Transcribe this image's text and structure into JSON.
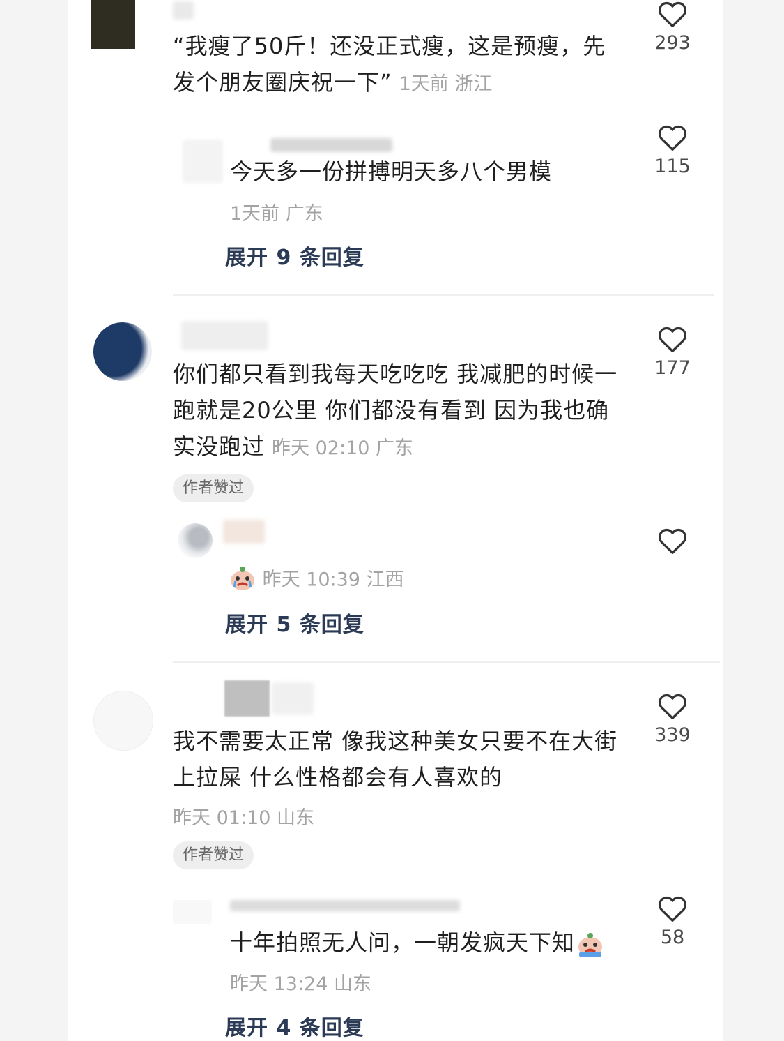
{
  "comments": [
    {
      "text": "“我瘦了50斤！还没正式瘦，这是预瘦，先发个朋友圈庆祝一下”",
      "meta": "1天前 浙江",
      "likes": "293",
      "reply": {
        "text": "今天多一份拼搏明天多八个男模",
        "meta": "1天前 广东",
        "likes": "115",
        "expand": "展开 9 条回复"
      }
    },
    {
      "text": "你们都只看到我每天吃吃吃 我减肥的时候一跑就是20公里 你们都没有看到 因为我也确实没跑过",
      "meta": "昨天 02:10 广东",
      "likes": "177",
      "badge": "作者赞过",
      "reply": {
        "emoji": "crying-face-icon",
        "meta": "昨天 10:39 江西",
        "expand": "展开 5 条回复"
      }
    },
    {
      "text": "我不需要太正常 像我这种美女只要不在大街上拉屎 什么性格都会有人喜欢的",
      "meta": "昨天 01:10 山东",
      "likes": "339",
      "badge": "作者赞过",
      "reply": {
        "text": "十年拍照无人问，一朝发疯天下知",
        "emoji": "crying-face-icon",
        "meta": "昨天 13:24 山东",
        "likes": "58",
        "expand": "展开 4 条回复"
      }
    }
  ],
  "colors": {
    "text": "#1f1f1f",
    "meta": "#a3a3a3",
    "expand": "#2b3a55",
    "badge_bg": "#eeeeee"
  }
}
